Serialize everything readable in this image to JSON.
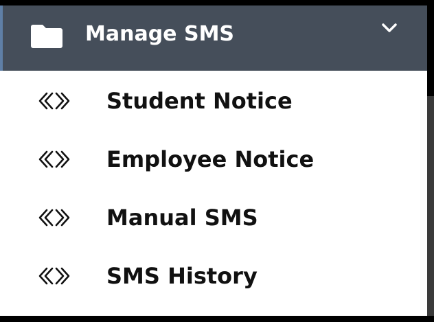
{
  "colors": {
    "header_background": "#454e5a",
    "header_accent": "#5f7fa6",
    "header_text": "#ffffff",
    "item_text": "#111111",
    "menu_background": "#ffffff"
  },
  "header": {
    "title": "Manage SMS",
    "icon": "folder-icon",
    "toggle_icon": "chevron-down-icon",
    "expanded": true
  },
  "menu": {
    "item_icon": "link-icon",
    "items": [
      {
        "label": "Student Notice"
      },
      {
        "label": "Employee Notice"
      },
      {
        "label": "Manual SMS"
      },
      {
        "label": "SMS History"
      }
    ]
  }
}
